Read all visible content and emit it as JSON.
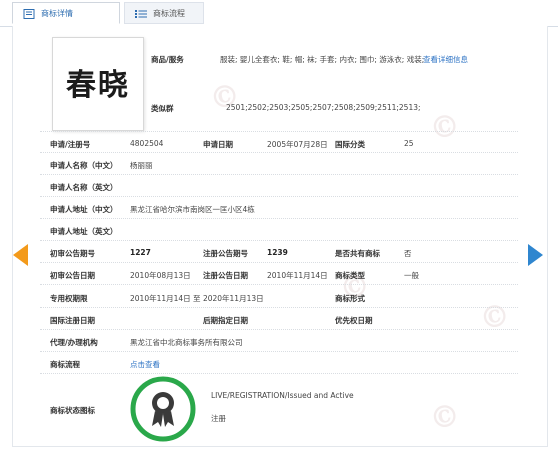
{
  "tabs": [
    {
      "label": "商标详情",
      "icon": "document-icon"
    },
    {
      "label": "商标流程",
      "icon": "list-icon"
    }
  ],
  "logo_text": "春晓",
  "goods_services": {
    "label": "商品/服务",
    "value": "服装; 婴儿全套衣; 鞋; 帽; 袜; 手套; 内衣; 围巾; 游泳衣; 戏装;",
    "link": "查看详细信息"
  },
  "similar_group": {
    "label": "类似群",
    "value": "2501;2502;2503;2505;2507;2508;2509;2511;2513;"
  },
  "fields": {
    "reg_no": {
      "label": "申请/注册号",
      "value": "4802504"
    },
    "app_date": {
      "label": "申请日期",
      "value": "2005年07月28日"
    },
    "intl_class": {
      "label": "国际分类",
      "value": "25"
    },
    "applicant_cn": {
      "label": "申请人名称（中文）",
      "value": "杨丽丽"
    },
    "applicant_en": {
      "label": "申请人名称（英文）",
      "value": ""
    },
    "address_cn": {
      "label": "申请人地址（中文）",
      "value": "黑龙江省哈尔滨市南岗区一匡小区4栋"
    },
    "address_en": {
      "label": "申请人地址（英文）",
      "value": ""
    },
    "prelim_no": {
      "label": "初审公告期号",
      "value": "1227"
    },
    "reg_pub_no": {
      "label": "注册公告期号",
      "value": "1239"
    },
    "shared": {
      "label": "是否共有商标",
      "value": "否"
    },
    "prelim_date": {
      "label": "初审公告日期",
      "value": "2010年08月13日"
    },
    "reg_pub_date": {
      "label": "注册公告日期",
      "value": "2010年11月14日"
    },
    "mark_type": {
      "label": "商标类型",
      "value": "一般"
    },
    "exclusive_period": {
      "label": "专用权期限",
      "value": "2010年11月14日 至 2020年11月13日"
    },
    "mark_form": {
      "label": "商标形式",
      "value": ""
    },
    "intl_reg_date": {
      "label": "国际注册日期",
      "value": ""
    },
    "later_date": {
      "label": "后期指定日期",
      "value": ""
    },
    "priority_date": {
      "label": "优先权日期",
      "value": ""
    },
    "agent": {
      "label": "代理/办理机构",
      "value": "黑龙江省中北商标事务所有限公司"
    },
    "process": {
      "label": "商标流程",
      "link": "点击查看"
    },
    "status": {
      "label": "商标状态图标",
      "status_en": "LIVE/REGISTRATION/Issued and Active",
      "status_cn": "注册"
    }
  },
  "colors": {
    "link": "#2d73c4",
    "prev_arrow": "#f39a1b",
    "next_arrow": "#2f86cf",
    "seal_ring": "#2aa84a"
  },
  "icons": [
    "arrow-left-icon",
    "arrow-right-icon",
    "registered-seal-icon"
  ]
}
